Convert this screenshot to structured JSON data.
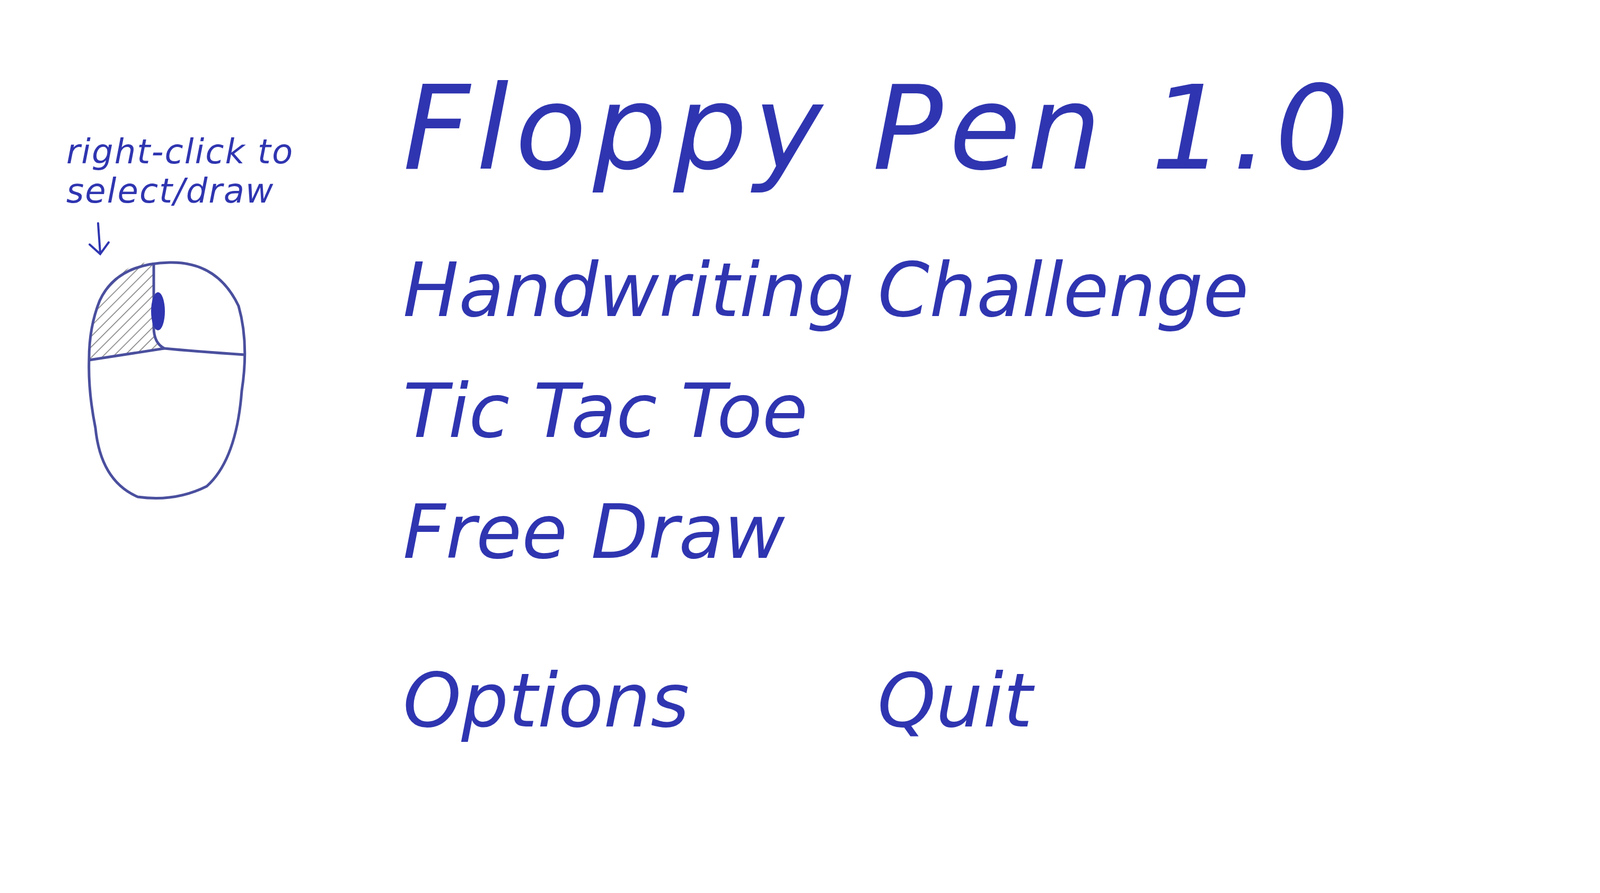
{
  "title": "Floppy Pen 1.0",
  "hint": {
    "lines": [
      "right-click to",
      "select/draw"
    ]
  },
  "menu": [
    {
      "label": "Handwriting Challenge"
    },
    {
      "label": "Tic Tac Toe"
    },
    {
      "label": "Free Draw"
    }
  ],
  "footer": [
    {
      "label": "Options"
    },
    {
      "label": "Quit"
    }
  ]
}
